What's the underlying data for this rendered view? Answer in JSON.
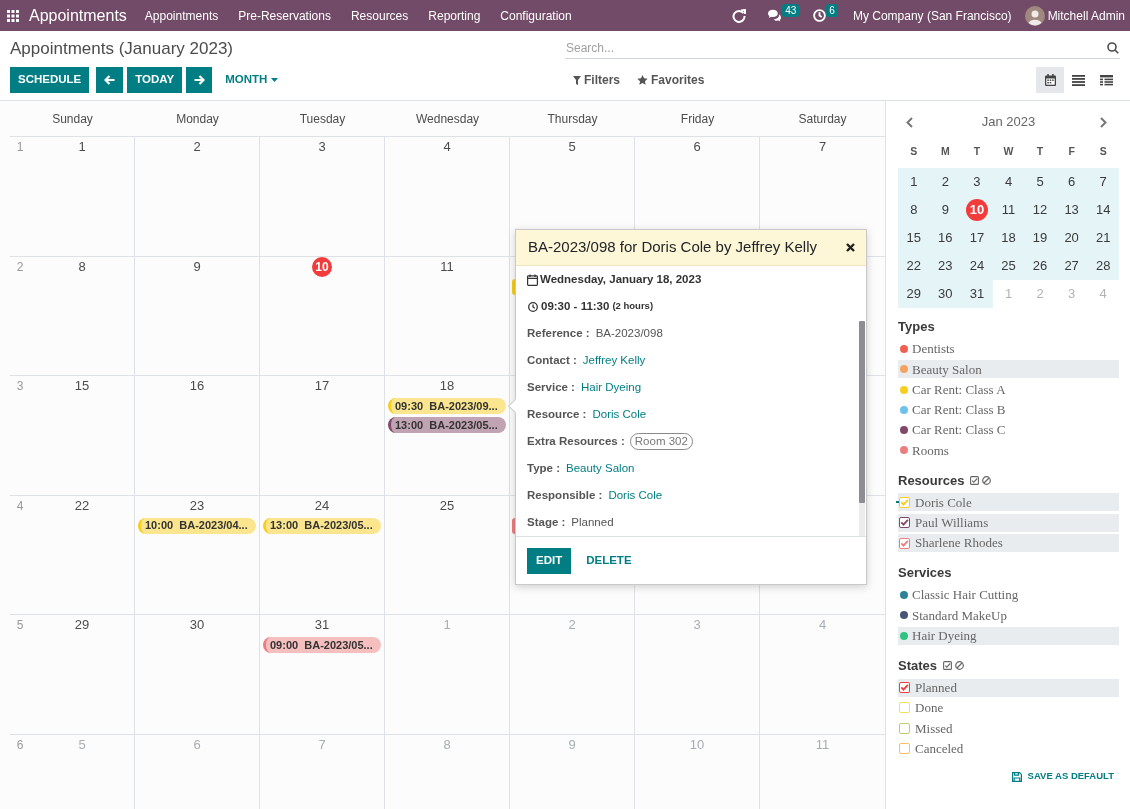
{
  "navbar": {
    "brand": "Appointments",
    "menu": [
      "Appointments",
      "Pre-Reservations",
      "Resources",
      "Reporting",
      "Configuration"
    ],
    "messages_badge": "43",
    "activities_badge": "6",
    "company": "My Company (San Francisco)",
    "user": "Mitchell Admin"
  },
  "control_panel": {
    "title": "Appointments (January 2023)",
    "search": {
      "placeholder": "Search..."
    },
    "schedule_button": "SCHEDULE",
    "today_button": "TODAY",
    "scale_dropdown": "MONTH",
    "filters": "Filters",
    "favorites": "Favorites",
    "views": [
      {
        "kind": "calendar",
        "selected": true
      },
      {
        "kind": "list",
        "selected": false
      },
      {
        "kind": "detailed_list",
        "selected": false
      }
    ]
  },
  "calendar": {
    "weekdays": [
      "Sunday",
      "Monday",
      "Tuesday",
      "Wednesday",
      "Thursday",
      "Friday",
      "Saturday"
    ],
    "weeks": [
      {
        "number": "1",
        "days": [
          {
            "day": "1",
            "in_month": true,
            "today": false
          },
          {
            "day": "2",
            "in_month": true,
            "today": false
          },
          {
            "day": "3",
            "in_month": true,
            "today": false
          },
          {
            "day": "4",
            "in_month": true,
            "today": false
          },
          {
            "day": "5",
            "in_month": true,
            "today": false
          },
          {
            "day": "6",
            "in_month": true,
            "today": false
          },
          {
            "day": "7",
            "in_month": true,
            "today": false
          }
        ]
      },
      {
        "number": "2",
        "days": [
          {
            "day": "8",
            "in_month": true,
            "today": false
          },
          {
            "day": "9",
            "in_month": true,
            "today": false
          },
          {
            "day": "10",
            "in_month": true,
            "today": true
          },
          {
            "day": "11",
            "in_month": true,
            "today": false
          },
          {
            "events": [
              {
                "kind": "stub",
                "color": "#f7cd1f"
              }
            ]
          }
        ]
      },
      {
        "number": "3",
        "days": [
          {
            "day": "15",
            "in_month": true,
            "today": false
          },
          {
            "day": "16",
            "in_month": true,
            "today": false
          },
          {
            "day": "17",
            "in_month": true,
            "today": false
          },
          {
            "day": "18",
            "in_month": true,
            "today": false,
            "events": [
              {
                "kind": "pill",
                "time": "09:30",
                "title": "BA-2023/09...",
                "color": "#f7cd1f"
              },
              {
                "kind": "pill",
                "time": "13:00",
                "title": "BA-2023/05...",
                "color": "#814968"
              }
            ]
          }
        ]
      },
      {
        "number": "4",
        "days": [
          {
            "day": "22",
            "in_month": true,
            "today": false
          },
          {
            "day": "23",
            "in_month": true,
            "today": false,
            "events": [
              {
                "kind": "pill",
                "time": "10:00",
                "title": "BA-2023/04...",
                "color": "#f7cd1f"
              }
            ]
          },
          {
            "day": "24",
            "in_month": true,
            "today": false,
            "events": [
              {
                "kind": "pill",
                "time": "13:00",
                "title": "BA-2023/05...",
                "color": "#f7cd1f"
              }
            ]
          },
          {
            "day": "25",
            "in_month": true,
            "today": false
          },
          {
            "events": [
              {
                "kind": "stub",
                "color": "#eb7e7f"
              }
            ]
          }
        ]
      },
      {
        "number": "5",
        "days": [
          {
            "day": "29",
            "in_month": true,
            "today": false
          },
          {
            "day": "30",
            "in_month": true,
            "today": false
          },
          {
            "day": "31",
            "in_month": true,
            "today": false,
            "events": [
              {
                "kind": "pill",
                "time": "09:00",
                "title": "BA-2023/05...",
                "color": "#eb7e7f"
              }
            ]
          },
          {
            "day": "1",
            "in_month": false,
            "today": false
          },
          {
            "day": "2",
            "in_month": false,
            "today": false
          },
          {
            "day": "3",
            "in_month": false,
            "today": false
          },
          {
            "day": "4",
            "in_month": false,
            "today": false
          }
        ]
      },
      {
        "number": "6",
        "days": [
          {
            "day": "5",
            "in_month": false,
            "today": false
          },
          {
            "day": "6",
            "in_month": false,
            "today": false
          },
          {
            "day": "7",
            "in_month": false,
            "today": false
          },
          {
            "day": "8",
            "in_month": false,
            "today": false
          },
          {
            "day": "9",
            "in_month": false,
            "today": false
          },
          {
            "day": "10",
            "in_month": false,
            "today": false
          },
          {
            "day": "11",
            "in_month": false,
            "today": false
          }
        ]
      }
    ]
  },
  "popover": {
    "title": "BA-2023/098 for Doris Cole by Jeffrey Kelly",
    "date": "Wednesday, January 18, 2023",
    "time": "09:30 - 11:30",
    "duration": "(2 hours)",
    "fields": [
      {
        "label": "Reference :",
        "value": "BA-2023/098",
        "kind": "text"
      },
      {
        "label": "Contact :",
        "value": "Jeffrey Kelly",
        "kind": "link"
      },
      {
        "label": "Service :",
        "value": "Hair Dyeing",
        "kind": "link"
      },
      {
        "label": "Resource :",
        "value": "Doris Cole",
        "kind": "link"
      },
      {
        "label": "Extra Resources :",
        "value": "Room 302",
        "kind": "tag"
      },
      {
        "label": "Type :",
        "value": "Beauty Salon",
        "kind": "link"
      },
      {
        "label": "Responsible :",
        "value": "Doris Cole",
        "kind": "link"
      },
      {
        "label": "Stage :",
        "value": "Planned",
        "kind": "text"
      }
    ],
    "edit_button": "EDIT",
    "delete_button": "DELETE"
  },
  "sidebar": {
    "mini_calendar": {
      "month": "Jan 2023",
      "weekdays": [
        "S",
        "M",
        "T",
        "W",
        "T",
        "F",
        "S"
      ],
      "weeks": [
        [
          {
            "day": "1",
            "in_month": true,
            "today": false
          },
          {
            "day": "2",
            "in_month": true,
            "today": false
          },
          {
            "day": "3",
            "in_month": true,
            "today": false
          },
          {
            "day": "4",
            "in_month": true,
            "today": false
          },
          {
            "day": "5",
            "in_month": true,
            "today": false
          },
          {
            "day": "6",
            "in_month": true,
            "today": false
          },
          {
            "day": "7",
            "in_month": true,
            "today": false
          }
        ],
        [
          {
            "day": "8",
            "in_month": true,
            "today": false
          },
          {
            "day": "9",
            "in_month": true,
            "today": false
          },
          {
            "day": "10",
            "in_month": true,
            "today": true
          },
          {
            "day": "11",
            "in_month": true,
            "today": false
          },
          {
            "day": "12",
            "in_month": true,
            "today": false
          },
          {
            "day": "13",
            "in_month": true,
            "today": false
          },
          {
            "day": "14",
            "in_month": true,
            "today": false
          }
        ],
        [
          {
            "day": "15",
            "in_month": true,
            "today": false
          },
          {
            "day": "16",
            "in_month": true,
            "today": false
          },
          {
            "day": "17",
            "in_month": true,
            "today": false
          },
          {
            "day": "18",
            "in_month": true,
            "today": false
          },
          {
            "day": "19",
            "in_month": true,
            "today": false
          },
          {
            "day": "20",
            "in_month": true,
            "today": false
          },
          {
            "day": "21",
            "in_month": true,
            "today": false
          }
        ],
        [
          {
            "day": "22",
            "in_month": true,
            "today": false
          },
          {
            "day": "23",
            "in_month": true,
            "today": false
          },
          {
            "day": "24",
            "in_month": true,
            "today": false
          },
          {
            "day": "25",
            "in_month": true,
            "today": false
          },
          {
            "day": "26",
            "in_month": true,
            "today": false
          },
          {
            "day": "27",
            "in_month": true,
            "today": false
          },
          {
            "day": "28",
            "in_month": true,
            "today": false
          }
        ],
        [
          {
            "day": "29",
            "in_month": true,
            "today": false
          },
          {
            "day": "30",
            "in_month": true,
            "today": false
          },
          {
            "day": "31",
            "in_month": true,
            "today": false
          },
          {
            "day": "1",
            "in_month": false,
            "today": false
          },
          {
            "day": "2",
            "in_month": false,
            "today": false
          },
          {
            "day": "3",
            "in_month": false,
            "today": false
          },
          {
            "day": "4",
            "in_month": false,
            "today": false
          }
        ]
      ]
    },
    "filters": [
      {
        "title": "Types",
        "kind": "dot",
        "items": [
          {
            "label": "Dentists",
            "color": "#f06050",
            "selected": false
          },
          {
            "label": "Beauty Salon",
            "color": "#f4a460",
            "selected": true
          },
          {
            "label": "Car Rent: Class A",
            "color": "#f7cd1f",
            "selected": false
          },
          {
            "label": "Car Rent: Class B",
            "color": "#6cc1ed",
            "selected": false
          },
          {
            "label": "Car Rent: Class C",
            "color": "#814968",
            "selected": false
          },
          {
            "label": "Rooms",
            "color": "#eb7e7f",
            "selected": false
          }
        ]
      },
      {
        "title": "Resources",
        "kind": "checkbox",
        "items": [
          {
            "label": "Doris Cole",
            "color": "#f7cd1f",
            "checked": true,
            "selected": true,
            "focused": true
          },
          {
            "label": "Paul Williams",
            "color": "#814968",
            "checked": true,
            "selected": true,
            "focused": false
          },
          {
            "label": "Sharlene Rhodes",
            "color": "#eb7e7f",
            "checked": true,
            "selected": true,
            "focused": false
          }
        ]
      },
      {
        "title": "Services",
        "kind": "dot",
        "items": [
          {
            "label": "Classic Hair Cutting",
            "color": "#2c8397",
            "selected": false
          },
          {
            "label": "Standard MakeUp",
            "color": "#475577",
            "selected": false
          },
          {
            "label": "Hair Dyeing",
            "color": "#30c381",
            "selected": true
          }
        ]
      },
      {
        "title": "States",
        "kind": "checkbox",
        "items": [
          {
            "label": "Planned",
            "color": "#f03d3d",
            "checked": true,
            "selected": true
          },
          {
            "label": "Done",
            "color": "#f2e15c",
            "checked": false,
            "selected": false
          },
          {
            "label": "Missed",
            "color": "#bcd06b",
            "checked": false,
            "selected": false
          },
          {
            "label": "Canceled",
            "color": "#f5c060",
            "checked": false,
            "selected": false
          }
        ]
      }
    ],
    "save_button": "SAVE AS DEFAULT"
  }
}
